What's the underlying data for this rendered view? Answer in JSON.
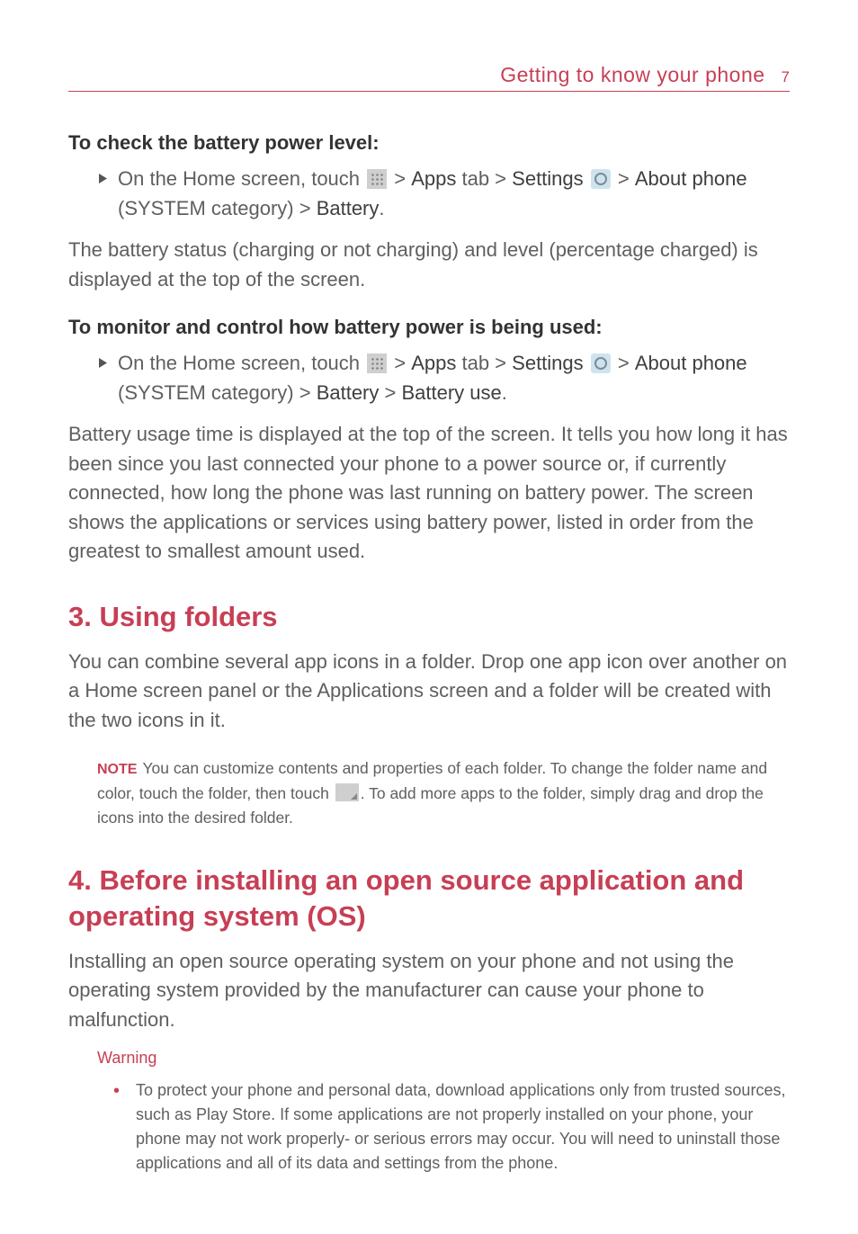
{
  "header": {
    "section_title": "Getting to know your phone",
    "page_number": "7"
  },
  "sec_battery_check": {
    "heading": "To check the battery power level:",
    "bullet_parts": {
      "p1": "On the Home screen, touch ",
      "p2": " > ",
      "p3": "Apps",
      "p4": " tab > ",
      "p5": "Settings",
      "p6": " ",
      "p7": " > ",
      "p8": "About phone",
      "p9": " (SYSTEM category) > ",
      "p10": "Battery",
      "p11": "."
    },
    "paragraph": "The battery status (charging or not charging) and level (percentage charged) is displayed at the top of the screen."
  },
  "sec_battery_monitor": {
    "heading": "To monitor and control how battery power is being used:",
    "bullet_parts": {
      "p1": "On the Home screen, touch ",
      "p2": " > ",
      "p3": "Apps",
      "p4": " tab > ",
      "p5": "Settings",
      "p6": " ",
      "p7": " > ",
      "p8": "About phone",
      "p9": " (SYSTEM category) > ",
      "p10": "Battery",
      "p11": " > ",
      "p12": "Battery use",
      "p13": "."
    },
    "paragraph": "Battery usage time is displayed at the top of the screen. It tells you how long it has been since you last connected your phone to a power source or, if currently connected, how long the phone was last running on battery power. The screen shows the applications or services using battery power, listed in order from the greatest to smallest amount used."
  },
  "sec_folders": {
    "heading": "3. Using folders",
    "paragraph": "You can combine several app icons in a folder. Drop one app icon over another on a Home screen panel or the Applications screen and a folder will be created with the two icons in it.",
    "note_label": "NOTE",
    "note_parts": {
      "p1": "You can customize contents and properties of each folder. To change the folder name and color, touch the folder, then touch ",
      "p2": ". To add more apps to the folder, simply drag and drop the icons into the desired folder."
    }
  },
  "sec_opensource": {
    "heading": "4. Before installing an open source application and operating system (OS)",
    "paragraph": "Installing an open source operating system on your phone and not using the operating system provided by the manufacturer can cause your phone to malfunction.",
    "warning_label": "Warning",
    "warning_bullet": "To protect your phone and personal data, download applications only from trusted sources, such as Play Store. If some applications are not properly installed on your phone, your phone may not work properly- or serious errors may occur. You will need to uninstall those applications and all of its data and settings from the phone."
  }
}
